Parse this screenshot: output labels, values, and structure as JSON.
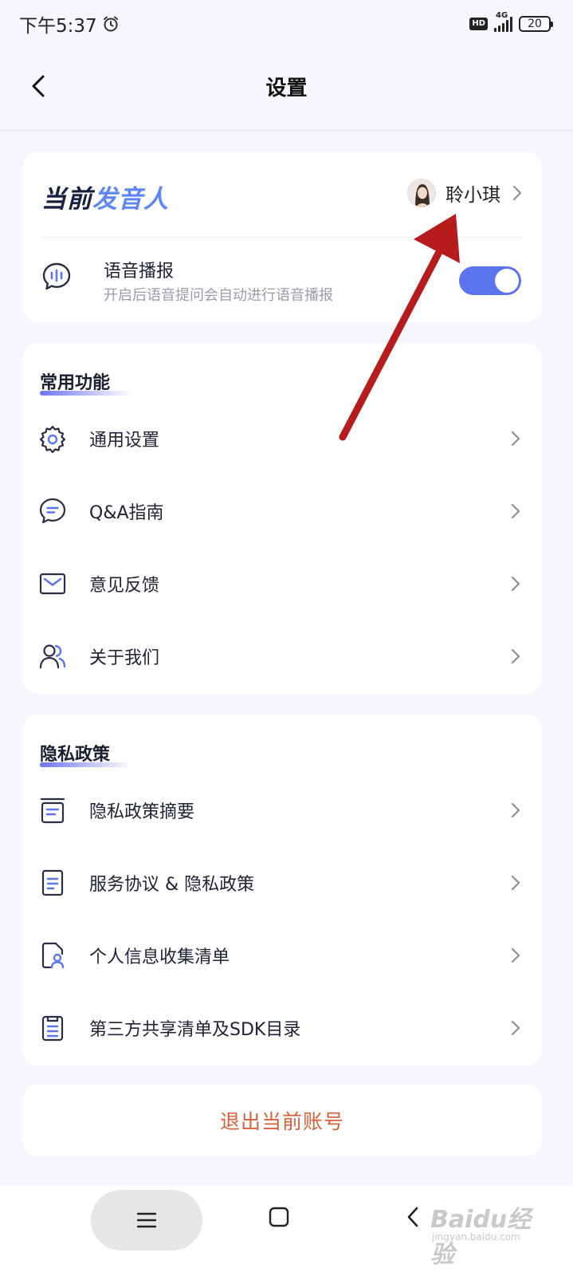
{
  "status_bar": {
    "time": "下午5:37",
    "hd": "HD",
    "network": "4G",
    "battery": "20"
  },
  "header": {
    "title": "设置"
  },
  "voice_card": {
    "title_part1": "当前",
    "title_part2": "发音人",
    "speaker_name": "聆小琪",
    "voice_label": "语音播报",
    "voice_desc": "开启后语音提问会自动进行语音播报",
    "voice_enabled": true
  },
  "common_functions": {
    "title": "常用功能",
    "items": [
      {
        "label": "通用设置",
        "icon": "gear-icon"
      },
      {
        "label": "Q&A指南",
        "icon": "chat-bubble-icon"
      },
      {
        "label": "意见反馈",
        "icon": "envelope-icon"
      },
      {
        "label": "关于我们",
        "icon": "users-icon"
      }
    ]
  },
  "privacy": {
    "title": "隐私政策",
    "items": [
      {
        "label": "隐私政策摘要",
        "icon": "document-summary-icon"
      },
      {
        "label": "服务协议 & 隐私政策",
        "icon": "document-icon"
      },
      {
        "label": "个人信息收集清单",
        "icon": "personal-info-icon"
      },
      {
        "label": "第三方共享清单及SDK目录",
        "icon": "clipboard-list-icon"
      }
    ]
  },
  "logout": {
    "label": "退出当前账号"
  },
  "watermark": {
    "main": "Baidu经验",
    "sub": "jingyan.baidu.com"
  },
  "colors": {
    "accent": "#5d74f0",
    "title_blue": "#5f86f5",
    "logout": "#d9603a",
    "annotation_arrow": "#b71c1c"
  }
}
